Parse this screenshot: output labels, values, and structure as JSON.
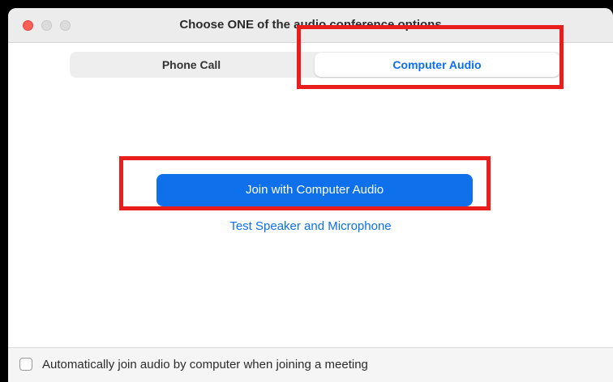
{
  "window": {
    "title": "Choose ONE of the audio conference options"
  },
  "tabs": {
    "phone_call": "Phone Call",
    "computer_audio": "Computer Audio",
    "selected": "Computer Audio"
  },
  "main": {
    "join_button_label": "Join with Computer Audio",
    "test_link_label": "Test Speaker and Microphone"
  },
  "footer": {
    "auto_join_label": "Automatically join audio by computer when joining a meeting",
    "auto_join_checked": false
  },
  "colors": {
    "accent": "#0e71eb",
    "link": "#0b6ff0",
    "highlight": "#ea1d1d",
    "close_button": "#fe5f57"
  },
  "icons": {
    "close": "close-window-icon",
    "minimize": "minimize-window-icon",
    "zoom": "zoom-window-icon"
  }
}
